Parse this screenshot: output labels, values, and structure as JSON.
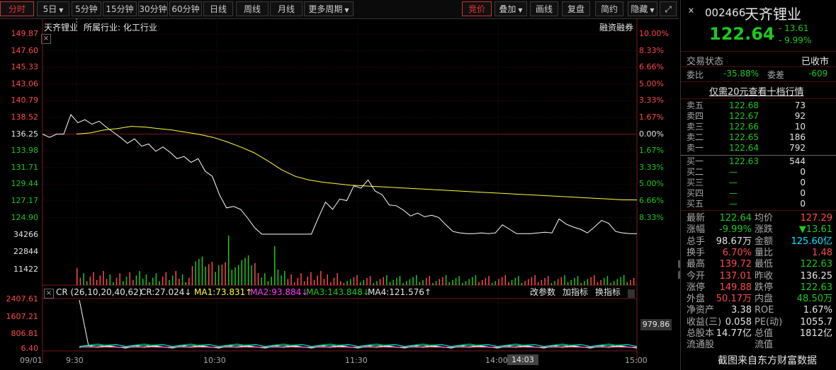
{
  "toolbar": {
    "tabs": [
      "分时",
      "5日",
      "5分钟",
      "15分钟",
      "30分钟",
      "60分钟",
      "日线",
      "周线",
      "月线",
      "更多周期"
    ],
    "right_buttons": [
      "竞价",
      "叠加",
      "画线",
      "复盘",
      "简约",
      "隐藏"
    ]
  },
  "header": {
    "stock_name": "天齐锂业",
    "industry": "所属行业:  化工行业",
    "margin": "融资融券"
  },
  "price_axis": {
    "left": [
      "149.87",
      "147.60",
      "145.33",
      "143.06",
      "140.79",
      "138.52",
      "136.25",
      "133.98",
      "131.71",
      "129.44",
      "127.17",
      "124.90"
    ],
    "right": [
      "10.00%",
      "8.33%",
      "6.66%",
      "5.00%",
      "3.33%",
      "1.67%",
      "0.00%",
      "1.67%",
      "3.33%",
      "5.00%",
      "6.66%",
      "8.33%"
    ]
  },
  "volume_axis": [
    "34266",
    "22844",
    "11422"
  ],
  "indicator": {
    "name": "CR (26,10,20,40,62)",
    "cr": "CR:27.024↓",
    "ma1": "MA1:73.831↑",
    "ma2": "MA2:93.884↓",
    "ma3": "MA3:143.848↓",
    "ma4": "MA4:121.576↑",
    "buttons": [
      "改参数",
      "加指标",
      "换指标"
    ],
    "axis": [
      "2407.61",
      "1607.21",
      "806.81",
      "6.40"
    ],
    "current": "979.86"
  },
  "time_axis": [
    "09/01",
    "9:30",
    "10:30",
    "11:30",
    "14:00",
    "14:03",
    "15:00"
  ],
  "quote": {
    "code": "002466",
    "name": "天齐锂业",
    "price": "122.64",
    "change": "- 13.61",
    "pct": "- 9.99%",
    "status_label": "交易状态",
    "status": "已收市",
    "weibi_label": "委比",
    "weibi": "-35.88%",
    "weicha_label": "委差",
    "weicha": "-609",
    "promo": "仅需20元查看十档行情",
    "asks": [
      [
        "卖五",
        "122.68",
        "73"
      ],
      [
        "卖四",
        "122.67",
        "92"
      ],
      [
        "卖三",
        "122.66",
        "10"
      ],
      [
        "卖二",
        "122.65",
        "186"
      ],
      [
        "卖一",
        "122.64",
        "792"
      ]
    ],
    "bids": [
      [
        "买一",
        "122.63",
        "544"
      ],
      [
        "买二",
        "—",
        "0"
      ],
      [
        "买三",
        "—",
        "0"
      ],
      [
        "买四",
        "—",
        "0"
      ],
      [
        "买五",
        "—",
        "0"
      ]
    ],
    "stats": [
      [
        "最新",
        "122.64",
        "均价",
        "127.29"
      ],
      [
        "涨幅",
        "-9.99%",
        "涨跌",
        "▼13.61"
      ],
      [
        "总手",
        "98.67万",
        "金额",
        "125.60亿"
      ],
      [
        "换手",
        "6.70%",
        "量比",
        "1.48"
      ],
      [
        "最高",
        "139.72",
        "最低",
        "122.63"
      ],
      [
        "今开",
        "137.01",
        "昨收",
        "136.25"
      ],
      [
        "涨停",
        "149.88",
        "跌停",
        "122.63"
      ],
      [
        "外盘",
        "50.17万",
        "内盘",
        "48.50万"
      ],
      [
        "净资产",
        "3.38",
        "ROE",
        "1.67%"
      ],
      [
        "收益(三)",
        "0.058",
        "PE(动)",
        "1055.7"
      ],
      [
        "总股本",
        "14.77亿",
        "总值",
        "1812亿"
      ],
      [
        "流通股",
        "",
        "流值",
        ""
      ]
    ],
    "watermark": "截图来自东方财富数据"
  },
  "chart_data": {
    "type": "line",
    "prev_close": 136.25,
    "price": [
      136.25,
      135.8,
      136.25,
      136.25,
      138.9,
      137.8,
      138.2,
      137.6,
      138.0,
      137.2,
      136.5,
      135.8,
      135.0,
      135.6,
      134.6,
      134.9,
      133.9,
      134.5,
      133.8,
      132.9,
      133.2,
      132.4,
      132.9,
      131.2,
      130.5,
      128.0,
      126.2,
      126.4,
      126.0,
      124.8,
      123.5,
      122.63,
      122.63,
      122.63,
      122.63,
      122.63,
      122.63,
      122.63,
      122.63,
      124.9,
      127.0,
      126.0,
      127.4,
      127.2,
      129.2,
      128.9,
      130.0,
      128.5,
      128.0,
      126.6,
      126.5,
      125.9,
      125.1,
      125.5,
      125.0,
      125.2,
      124.9,
      123.9,
      123.0,
      122.8,
      122.7,
      122.7,
      122.8,
      122.7,
      122.8,
      123.9,
      123.3,
      122.7,
      122.7,
      122.7,
      122.8,
      122.9,
      122.8,
      124.7,
      124.0,
      123.6,
      123.3,
      122.8,
      123.6,
      124.5,
      124.1,
      123.0,
      122.8,
      122.7,
      122.7
    ],
    "avg": [
      136.25,
      136.4,
      136.8,
      137.0,
      137.3,
      137.2,
      137.0,
      136.8,
      136.5,
      136.2,
      135.8,
      135.2,
      134.5,
      133.7,
      132.6,
      131.4,
      130.5,
      130.0,
      129.7,
      129.5,
      129.3,
      129.2,
      129.1,
      129.0,
      128.9,
      128.8,
      128.7,
      128.6,
      128.5,
      128.4,
      128.3,
      128.2,
      128.1,
      128.0,
      127.9,
      127.8,
      127.7,
      127.6,
      127.5,
      127.4,
      127.3,
      127.29
    ]
  }
}
